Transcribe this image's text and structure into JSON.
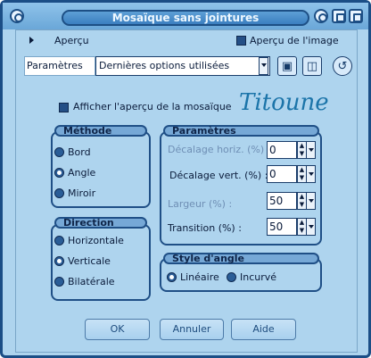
{
  "window": {
    "title": "Mosaïque sans jointures"
  },
  "preview": {
    "label": "Aperçu",
    "image_preview_label": "Aperçu de l'image"
  },
  "params": {
    "label": "Paramètres",
    "value": "Dernières options utilisées"
  },
  "show_preview": {
    "label": "Afficher l'aperçu de la mosaïque"
  },
  "signature": "Titoune",
  "methode": {
    "title": "Méthode",
    "options": [
      "Bord",
      "Angle",
      "Miroir"
    ],
    "selected": "Angle"
  },
  "direction": {
    "title": "Direction",
    "options": [
      "Horizontale",
      "Verticale",
      "Bilatérale"
    ],
    "selected": "Verticale"
  },
  "parametres": {
    "title": "Paramètres",
    "fields": [
      {
        "label": "Décalage horiz. (%) :",
        "value": "0",
        "enabled": false
      },
      {
        "label": "Décalage vert. (%) :",
        "value": "0",
        "enabled": true
      },
      {
        "label": "Largeur (%) :",
        "value": "50",
        "enabled": false
      },
      {
        "label": "Transition (%) :",
        "value": "50",
        "enabled": true
      }
    ]
  },
  "style_angle": {
    "title": "Style d'angle",
    "options": [
      "Linéaire",
      "Incurvé"
    ],
    "selected": "Linéaire"
  },
  "buttons": {
    "ok": "OK",
    "cancel": "Annuler",
    "help": "Aide"
  },
  "colors": {
    "background": "#aed4ee",
    "accent": "#1f4f86",
    "signature": "#1b74a9"
  }
}
